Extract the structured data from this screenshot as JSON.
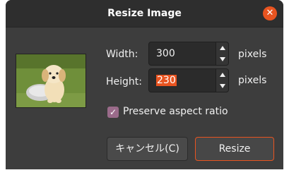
{
  "dialog": {
    "title": "Resize Image",
    "close_icon": "close-icon"
  },
  "form": {
    "width_label": "Width:",
    "width_value": "300",
    "height_label": "Height:",
    "height_value": "230",
    "units": "pixels",
    "preserve_label": "Preserve aspect ratio",
    "preserve_checked": true
  },
  "buttons": {
    "cancel": "キャンセル(C)",
    "resize": "Resize"
  },
  "colors": {
    "accent": "#e95420",
    "checkbox": "#9a6b8a",
    "background": "#3d3d3d"
  }
}
